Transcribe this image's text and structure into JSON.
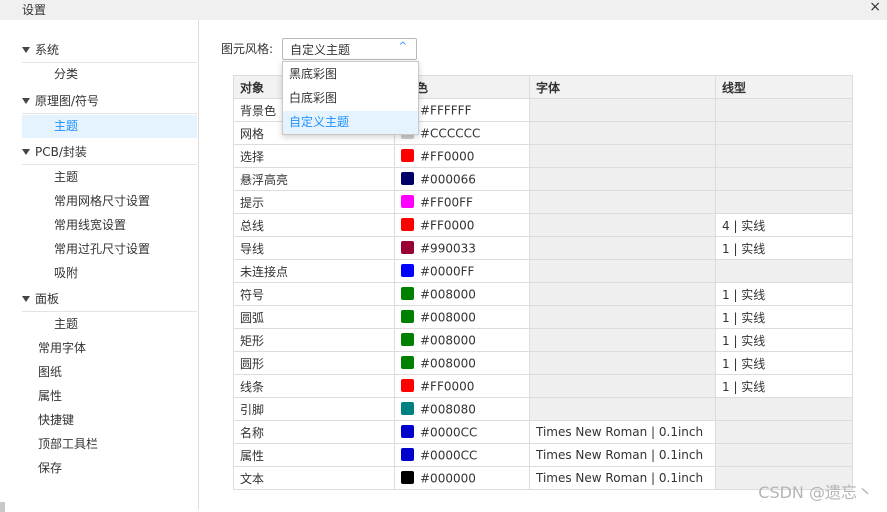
{
  "window": {
    "title": "设置",
    "close_glyph": "×"
  },
  "sidebar": {
    "items": [
      {
        "label": "系统"
      },
      {
        "label": "分类"
      },
      {
        "label": "原理图/符号"
      },
      {
        "label": "主题"
      },
      {
        "label": "PCB/封装"
      },
      {
        "label": "主题"
      },
      {
        "label": "常用网格尺寸设置"
      },
      {
        "label": "常用线宽设置"
      },
      {
        "label": "常用过孔尺寸设置"
      },
      {
        "label": "吸附"
      },
      {
        "label": "面板"
      },
      {
        "label": "主题"
      },
      {
        "label": "常用字体"
      },
      {
        "label": "图纸"
      },
      {
        "label": "属性"
      },
      {
        "label": "快捷键"
      },
      {
        "label": "顶部工具栏"
      },
      {
        "label": "保存"
      }
    ]
  },
  "style_selector": {
    "label": "图元风格:",
    "value": "自定义主题",
    "chevron": "^",
    "options": [
      "黑底彩图",
      "白底彩图",
      "自定义主题"
    ]
  },
  "table": {
    "headers": [
      "对象",
      "颜色",
      "字体",
      "线型"
    ],
    "header_visible_color_fragment": "色",
    "rows": [
      {
        "obj": "背景色",
        "hex": "#FFFFFF",
        "font": "",
        "line": ""
      },
      {
        "obj": "网格",
        "hex": "#CCCCCC",
        "font": "",
        "line": ""
      },
      {
        "obj": "选择",
        "hex": "#FF0000",
        "font": "",
        "line": ""
      },
      {
        "obj": "悬浮高亮",
        "hex": "#000066",
        "font": "",
        "line": ""
      },
      {
        "obj": "提示",
        "hex": "#FF00FF",
        "font": "",
        "line": ""
      },
      {
        "obj": "总线",
        "hex": "#FF0000",
        "font": "",
        "line": "4 | 实线"
      },
      {
        "obj": "导线",
        "hex": "#990033",
        "font": "",
        "line": "1 | 实线"
      },
      {
        "obj": "未连接点",
        "hex": "#0000FF",
        "font": "",
        "line": ""
      },
      {
        "obj": "符号",
        "hex": "#008000",
        "font": "",
        "line": "1 | 实线"
      },
      {
        "obj": "圆弧",
        "hex": "#008000",
        "font": "",
        "line": "1 | 实线"
      },
      {
        "obj": "矩形",
        "hex": "#008000",
        "font": "",
        "line": "1 | 实线"
      },
      {
        "obj": "圆形",
        "hex": "#008000",
        "font": "",
        "line": "1 | 实线"
      },
      {
        "obj": "线条",
        "hex": "#FF0000",
        "font": "",
        "line": "1 | 实线"
      },
      {
        "obj": "引脚",
        "hex": "#008080",
        "font": "",
        "line": ""
      },
      {
        "obj": "名称",
        "hex": "#0000CC",
        "font": "Times New Roman | 0.1inch",
        "line": ""
      },
      {
        "obj": "属性",
        "hex": "#0000CC",
        "font": "Times New Roman | 0.1inch",
        "line": ""
      },
      {
        "obj": "文本",
        "hex": "#000000",
        "font": "Times New Roman | 0.1inch",
        "line": ""
      }
    ]
  },
  "watermark": "CSDN @遗忘丶",
  "colors": {
    "accent": "#1E90FF",
    "selection_bg": "#E5F3FF"
  }
}
